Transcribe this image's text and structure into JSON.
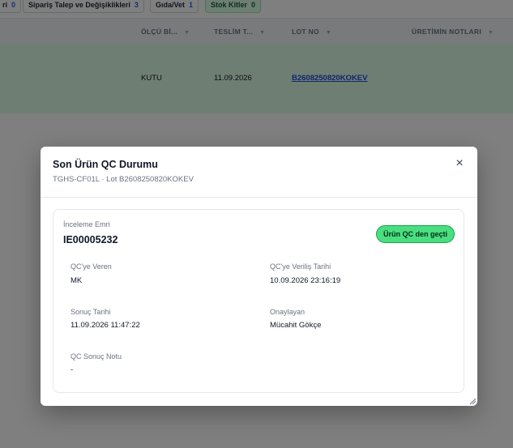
{
  "tabs": [
    {
      "label": "ri",
      "count": "0"
    },
    {
      "label": "Sipariş Talep ve Değişiklikleri",
      "count": "3"
    },
    {
      "label": "Gıda/Vet",
      "count": "1"
    },
    {
      "label": "Stok Kitler",
      "count": "0"
    }
  ],
  "table": {
    "columns": [
      "ÖLÇÜ Bİ...",
      "TESLİM T...",
      "LOT NO",
      "ÜRETİMİN NOTLARI"
    ],
    "row": {
      "unit": "KUTU",
      "delivery": "11.09.2026",
      "lot": "B2608250820KOKEV"
    }
  },
  "modal": {
    "title": "Son Ürün QC Durumu",
    "subtitle": "TGHS-CF01L · Lot B2608250820KOKEV",
    "close_label": "×",
    "order_label": "İnceleme Emri",
    "order_value": "IE00005232",
    "status": "Ürün QC den geçti",
    "fields": {
      "giver_label": "QC'ye Veren",
      "giver_value": "MK",
      "given_date_label": "QC'ye Veriliş Tarihi",
      "given_date_value": "10.09.2026 23:16:19",
      "result_date_label": "Sonuç Tarihi",
      "result_date_value": "11.09.2026 11:47:22",
      "approver_label": "Onaylayan",
      "approver_value": "Mücahit Gökçe",
      "note_label": "QC Sonuç Notu",
      "note_value": "-"
    }
  },
  "colors": {
    "row_highlight": "#dcfce7",
    "badge_bg": "#4ade80",
    "link": "#1d4ed8"
  }
}
